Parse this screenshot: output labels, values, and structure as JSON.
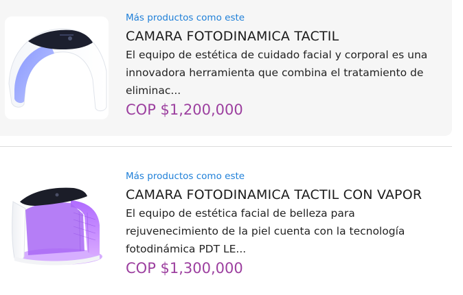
{
  "products": [
    {
      "more_label": "Más productos como este",
      "title": "CAMARA FOTODINAMICA TACTIL",
      "description": "El equipo de estética de cuidado facial y corporal es una innovadora herramienta que combina el tratamiento de eliminac...",
      "price": "COP $1,200,000"
    },
    {
      "more_label": "Más productos como este",
      "title": "CAMARA FOTODINAMICA TACTIL CON VAPOR",
      "description": "El equipo de estética facial de belleza para rejuvenecimiento de la piel cuenta con la tecnología fotodinámica PDT LE...",
      "price": "COP $1,300,000"
    }
  ],
  "colors": {
    "link": "#1e7fd8",
    "price": "#9c3f9f",
    "card_bg": "#f6f6f6",
    "divider": "#dcdcdc"
  },
  "icons": {
    "product_1_image": "pdt-led-dome-device-image",
    "product_2_image": "pdt-led-vapor-device-image"
  }
}
